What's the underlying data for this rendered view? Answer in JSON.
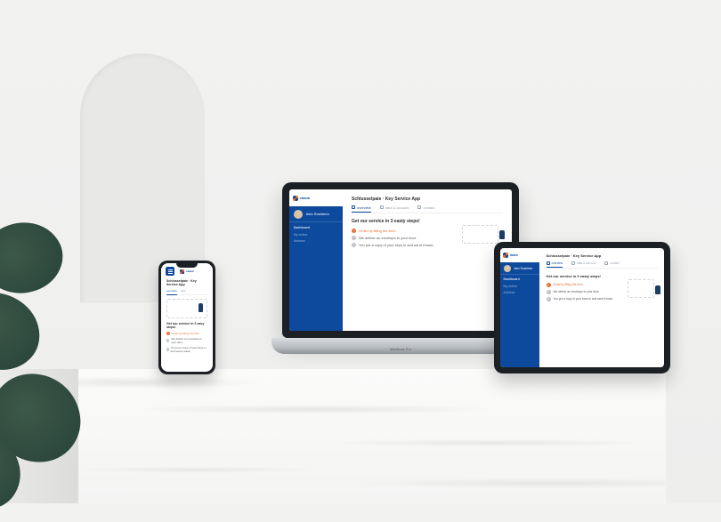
{
  "brand": "ebank",
  "user_name": "Alex Rushteen",
  "sidebar": {
    "section_label": "Dashboard",
    "items": [
      "My orders",
      "Address"
    ]
  },
  "page_title": "Schlusselpaie · Key Service App",
  "tabs": [
    {
      "label": "overview"
    },
    {
      "label": "data & account"
    },
    {
      "label": "contact"
    }
  ],
  "headline": "Get our service in 3 easty steps!",
  "steps": [
    "Order by filling the form.",
    "We deliver an envelope to your door.",
    "You put a copy of your keys in and send it back."
  ],
  "laptop_model": "MacBook Pro",
  "phone": {
    "title": "Schlusselpaie · Key Service App",
    "tabs": [
      "overview",
      "data"
    ],
    "headline": "Get our service in 3 easy steps!"
  }
}
